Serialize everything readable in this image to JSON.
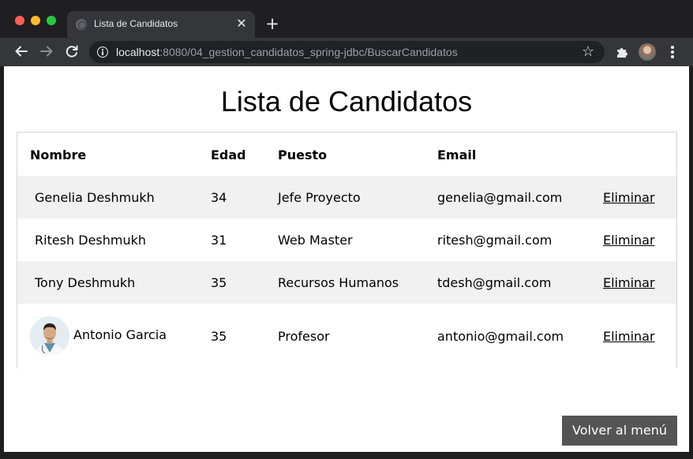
{
  "browser": {
    "tab_title": "Lista de Candidatos",
    "tab_close": "✕",
    "new_tab": "+",
    "url_host": "localhost",
    "url_rest": ":8080/04_gestion_candidatos_spring-jdbc/BuscarCandidatos",
    "bookmark_icon": "☆",
    "colors": {
      "chrome": "#35363a",
      "tabstrip": "#1f1f21",
      "omnibox": "#202124"
    }
  },
  "page": {
    "title": "Lista de Candidatos",
    "back_button": "Volver al menú"
  },
  "table": {
    "headers": {
      "name": "Nombre",
      "age": "Edad",
      "job": "Puesto",
      "email": "Email"
    },
    "rows": [
      {
        "name": "Genelia Deshmukh",
        "age": "34",
        "job": "Jefe Proyecto",
        "email": "genelia@gmail.com",
        "action": "Eliminar"
      },
      {
        "name": "Ritesh Deshmukh",
        "age": "31",
        "job": "Web Master",
        "email": "ritesh@gmail.com",
        "action": "Eliminar"
      },
      {
        "name": "Tony Deshmukh",
        "age": "35",
        "job": "Recursos Humanos",
        "email": "tdesh@gmail.com",
        "action": "Eliminar"
      },
      {
        "name": "Antonio Garcia",
        "age": "35",
        "job": "Profesor",
        "email": "antonio@gmail.com",
        "action": "Eliminar",
        "photo": "doctor-portrait"
      }
    ],
    "colors": {
      "stripe": "#f1f1f1",
      "border": "#d4d4d4",
      "button": "#555555"
    }
  }
}
